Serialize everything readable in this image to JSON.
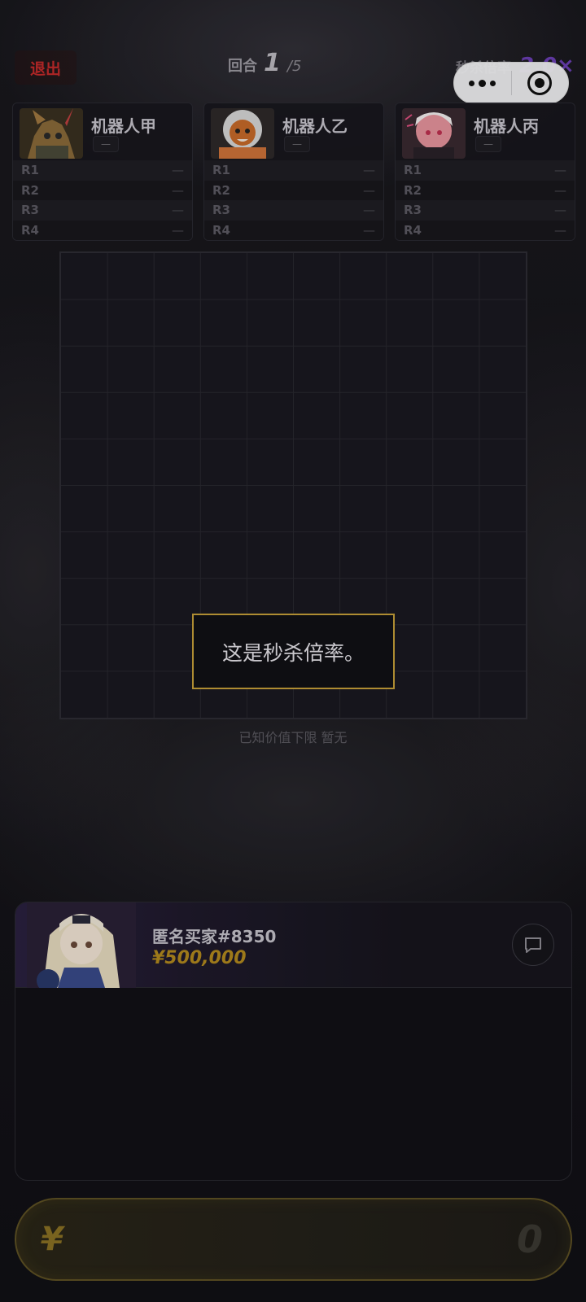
{
  "topbar": {
    "exit_label": "退出",
    "round_label": "回合",
    "round_current": "1",
    "round_total": "/5",
    "multiplier_label": "秒杀倍率",
    "multiplier_value": "2.0×"
  },
  "players": [
    {
      "name": "机器人甲",
      "badge": "—",
      "rows": [
        {
          "label": "R1",
          "value": "—"
        },
        {
          "label": "R2",
          "value": "—"
        },
        {
          "label": "R3",
          "value": "—"
        },
        {
          "label": "R4",
          "value": "—"
        }
      ]
    },
    {
      "name": "机器人乙",
      "badge": "—",
      "rows": [
        {
          "label": "R1",
          "value": "—"
        },
        {
          "label": "R2",
          "value": "—"
        },
        {
          "label": "R3",
          "value": "—"
        },
        {
          "label": "R4",
          "value": "—"
        }
      ]
    },
    {
      "name": "机器人丙",
      "badge": "—",
      "rows": [
        {
          "label": "R1",
          "value": "—"
        },
        {
          "label": "R2",
          "value": "—"
        },
        {
          "label": "R3",
          "value": "—"
        },
        {
          "label": "R4",
          "value": "—"
        }
      ]
    }
  ],
  "board": {
    "lower_bound_text": "已知价值下限 暂无"
  },
  "tooltip": {
    "text": "这是秒杀倍率。"
  },
  "buyer": {
    "name": "匿名买家#8350",
    "bid": "¥500,000"
  },
  "bid_input": {
    "currency": "¥",
    "value": "0"
  },
  "colors": {
    "accent_gold": "#c6a03a",
    "exit_red": "#c42b2b",
    "multiplier_purple": "#6b3fb5"
  }
}
